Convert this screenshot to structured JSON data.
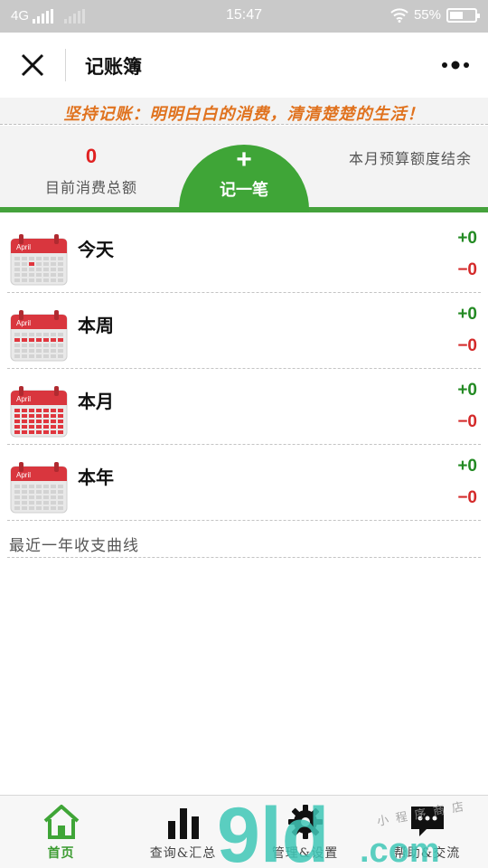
{
  "status_bar": {
    "network": "4G",
    "time": "15:47",
    "battery_percent": "55%",
    "battery_level": 0.55
  },
  "nav": {
    "title": "记账簿",
    "close_icon": "close-icon",
    "more_icon": "more-icon"
  },
  "slogan": "坚持记账：明明白白的消费，清清楚楚的生活！",
  "summary": {
    "total_value": "0",
    "total_label": "目前消费总额",
    "add_plus": "+",
    "add_label": "记一笔",
    "budget_label": "本月预算额度结余"
  },
  "periods": [
    {
      "label": "今天",
      "income": "+0",
      "expense": "−0",
      "icon": "calendar-day-icon"
    },
    {
      "label": "本周",
      "income": "+0",
      "expense": "−0",
      "icon": "calendar-week-icon"
    },
    {
      "label": "本月",
      "income": "+0",
      "expense": "−0",
      "icon": "calendar-month-icon"
    },
    {
      "label": "本年",
      "income": "+0",
      "expense": "−0",
      "icon": "calendar-year-icon"
    }
  ],
  "calendar_badge": "April",
  "curve_title": "最近一年收支曲线",
  "tabs": [
    {
      "label": "首页",
      "icon": "home-icon",
      "active": true
    },
    {
      "label": "查询&汇总",
      "icon": "bar-chart-icon",
      "active": false
    },
    {
      "label": "管理&设置",
      "icon": "gear-icon",
      "active": false
    },
    {
      "label": "帮助&交流",
      "icon": "chat-icon",
      "active": false
    }
  ],
  "watermark": {
    "main": "9ld",
    "suffix": ".com",
    "side_text": "小程序商店"
  },
  "colors": {
    "accent_green": "#3fa537",
    "income_green": "#238a23",
    "expense_red": "#d42a2a",
    "slogan_orange": "#e0721e",
    "watermark_teal": "#3fc7b7"
  }
}
